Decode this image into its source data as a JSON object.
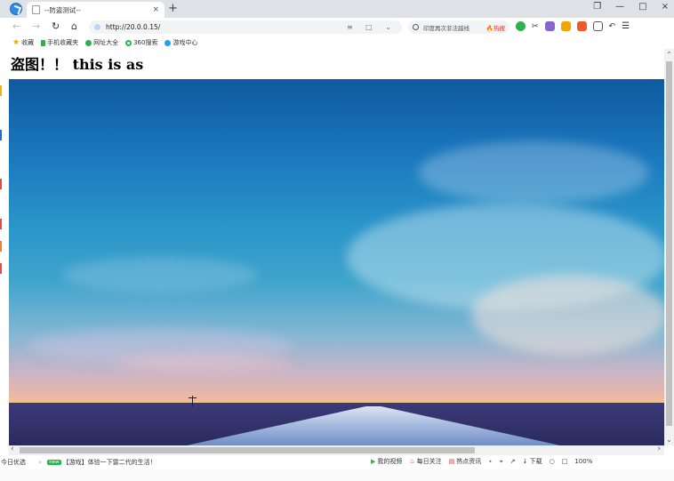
{
  "tab": {
    "title": "--防盗测试--",
    "close": "×",
    "new_tab": "+"
  },
  "window": {
    "buttons": [
      "❐",
      "—",
      "□",
      "×"
    ]
  },
  "nav": {
    "back": "←",
    "forward": "→",
    "reload": "↻",
    "home": "⌂"
  },
  "address": {
    "url": "http://20.0.0.15/",
    "actions": "≡ □ ⌄"
  },
  "search": {
    "placeholder": "印度再次非法越线",
    "hot": "🔥热搜"
  },
  "bookmarks": [
    {
      "label": "收藏",
      "icon": "star-icon",
      "color": "#f0a500"
    },
    {
      "label": "手机收藏夹",
      "icon": "phone-icon",
      "color": "#2bb24c"
    },
    {
      "label": "网址大全",
      "icon": "globe-icon",
      "color": "#2bb24c"
    },
    {
      "label": "360搜索",
      "icon": "search-360-icon",
      "color": "#1ea1f2"
    },
    {
      "label": "游戏中心",
      "icon": "game-icon",
      "color": "#1ea1f2"
    }
  ],
  "page": {
    "heading": "盗图！！ this is as"
  },
  "statusbar": {
    "left_label": "今日优选",
    "badge": "new",
    "news": "【游戏】体验一下雷二代的生活！",
    "right": [
      "我的视频",
      "每日关注",
      "热点资讯",
      "⋆",
      "⌖",
      "↗",
      "↓ 下载",
      "○",
      "□",
      "100%"
    ]
  },
  "colors": {
    "accent": "#2f8ae8",
    "hot": "#e0322b",
    "green": "#2bb24c"
  }
}
